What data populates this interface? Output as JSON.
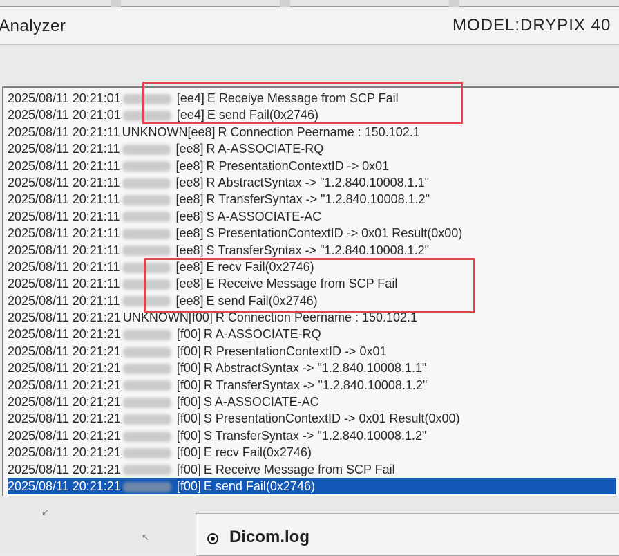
{
  "app_title": "Analyzer",
  "model_label": "MODEL:DRYPIX 40",
  "log": {
    "entries": [
      {
        "date": "2025/08/11",
        "time": "20:21:01",
        "host": "",
        "tag": "[ee4]",
        "msg": "E Receiye Message from SCP Fail"
      },
      {
        "date": "2025/08/11",
        "time": "20:21:01",
        "host": "",
        "tag": "[ee4]",
        "msg": "E send  Fail(0x2746)"
      },
      {
        "date": "2025/08/11",
        "time": "20:21:11",
        "host": "UNKNOWN",
        "tag": "[ee8]",
        "msg": "R Connection Peername : 150.102.1"
      },
      {
        "date": "2025/08/11",
        "time": "20:21:11",
        "host": "",
        "tag": "[ee8]",
        "msg": "R A-ASSOCIATE-RQ"
      },
      {
        "date": "2025/08/11",
        "time": "20:21:11",
        "host": "",
        "tag": "[ee8]",
        "msg": "R PresentationContextID -> 0x01"
      },
      {
        "date": "2025/08/11",
        "time": "20:21:11",
        "host": "",
        "tag": "[ee8]",
        "msg": "R AbstractSyntax -> \"1.2.840.10008.1.1\""
      },
      {
        "date": "2025/08/11",
        "time": "20:21:11",
        "host": "",
        "tag": "[ee8]",
        "msg": "R TransferSyntax -> \"1.2.840.10008.1.2\""
      },
      {
        "date": "2025/08/11",
        "time": "20:21:11",
        "host": "",
        "tag": "[ee8]",
        "msg": "S A-ASSOCIATE-AC"
      },
      {
        "date": "2025/08/11",
        "time": "20:21:11",
        "host": "",
        "tag": "[ee8]",
        "msg": "S PresentationContextID -> 0x01 Result(0x00)"
      },
      {
        "date": "2025/08/11",
        "time": "20:21:11",
        "host": "",
        "tag": "[ee8]",
        "msg": "S TransferSyntax -> \"1.2.840.10008.1.2\""
      },
      {
        "date": "2025/08/11",
        "time": "20:21:11",
        "host": "",
        "tag": "[ee8]",
        "msg": "E recv  Fail(0x2746)"
      },
      {
        "date": "2025/08/11",
        "time": "20:21:11",
        "host": "",
        "tag": "[ee8]",
        "msg": "E Receive Message from SCP Fail"
      },
      {
        "date": "2025/08/11",
        "time": "20:21:11",
        "host": "",
        "tag": "[ee8]",
        "msg": "E send  Fail(0x2746)"
      },
      {
        "date": "2025/08/11",
        "time": "20:21:21",
        "host": "UNKNOWN",
        "tag": "[f00]",
        "msg": "R Connection Peername : 150.102.1"
      },
      {
        "date": "2025/08/11",
        "time": "20:21:21",
        "host": "",
        "tag": "[f00]",
        "msg": "R A-ASSOCIATE-RQ"
      },
      {
        "date": "2025/08/11",
        "time": "20:21:21",
        "host": "",
        "tag": "[f00]",
        "msg": "R PresentationContextID -> 0x01"
      },
      {
        "date": "2025/08/11",
        "time": "20:21:21",
        "host": "",
        "tag": "[f00]",
        "msg": "R AbstractSyntax -> \"1.2.840.10008.1.1\""
      },
      {
        "date": "2025/08/11",
        "time": "20:21:21",
        "host": "",
        "tag": "[f00]",
        "msg": "R TransferSyntax -> \"1.2.840.10008.1.2\""
      },
      {
        "date": "2025/08/11",
        "time": "20:21:21",
        "host": "",
        "tag": "[f00]",
        "msg": "S A-ASSOCIATE-AC"
      },
      {
        "date": "2025/08/11",
        "time": "20:21:21",
        "host": "",
        "tag": "[f00]",
        "msg": "S PresentationContextID -> 0x01 Result(0x00)"
      },
      {
        "date": "2025/08/11",
        "time": "20:21:21",
        "host": "",
        "tag": "[f00]",
        "msg": "S TransferSyntax -> \"1.2.840.10008.1.2\""
      },
      {
        "date": "2025/08/11",
        "time": "20:21:21",
        "host": "",
        "tag": "[f00]",
        "msg": "E recv  Fail(0x2746)"
      },
      {
        "date": "2025/08/11",
        "time": "20:21:21",
        "host": "",
        "tag": "[f00]",
        "msg": "E Receive Message from SCP Fail"
      },
      {
        "date": "2025/08/11",
        "time": "20:21:21",
        "host": "",
        "tag": "[f00]",
        "msg": "E send  Fail(0x2746)"
      }
    ],
    "selected_index": 23,
    "highlight_color": "#e0444c",
    "selection_color": "#1458b8"
  },
  "log_selector": {
    "options": [
      {
        "label": "Dicom.log",
        "selected": true
      }
    ]
  }
}
